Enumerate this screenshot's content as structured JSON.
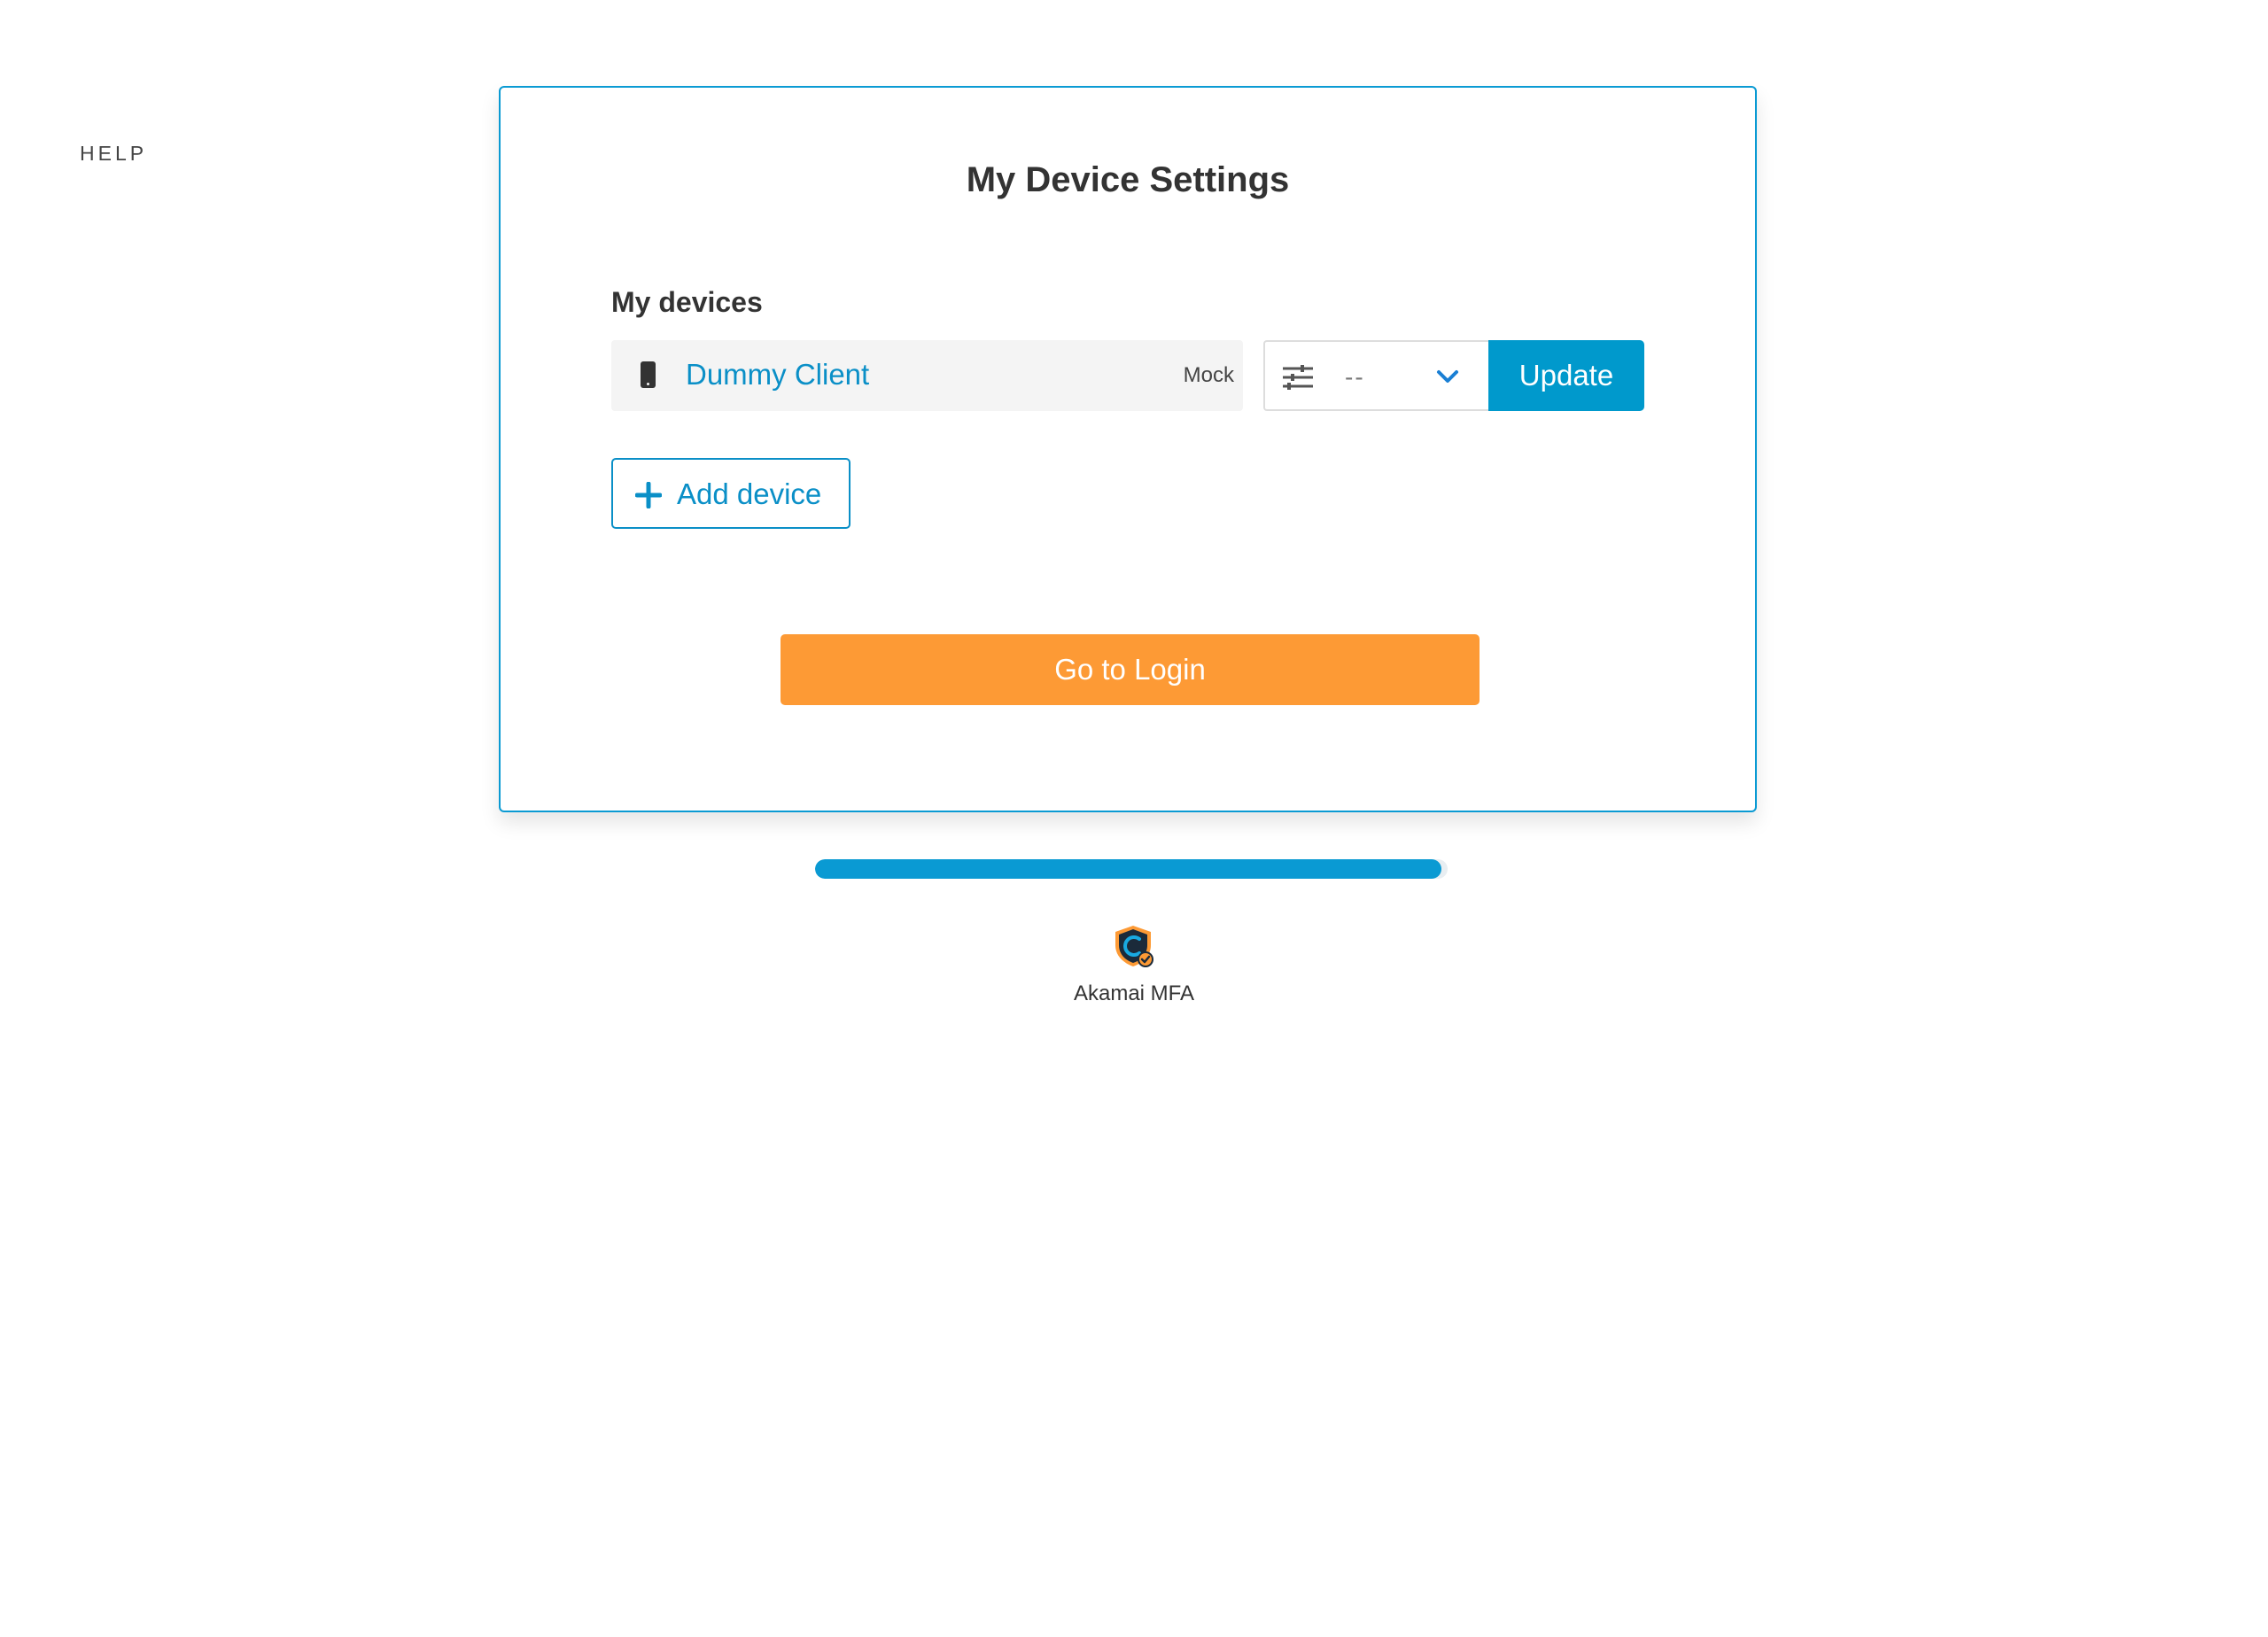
{
  "nav": {
    "help_label": "HELP"
  },
  "card": {
    "title": "My Device Settings",
    "section_label": "My devices",
    "devices": [
      {
        "name": "Dummy Client",
        "type": "Mock",
        "icon": "mobile-phone-icon"
      }
    ],
    "action_select": {
      "icon": "sliders-icon",
      "selected_value": "--",
      "chevron_icon": "chevron-down-icon"
    },
    "update_label": "Update",
    "add_device_label": "Add device",
    "login_label": "Go to Login"
  },
  "progress": {
    "value_percent": 99
  },
  "footer": {
    "brand_name": "Akamai MFA",
    "logo_icon": "akamai-shield-icon"
  },
  "colors": {
    "accent": "#0a9ad3",
    "login_button": "#fd9a35",
    "device_row_bg": "#f4f4f4"
  }
}
